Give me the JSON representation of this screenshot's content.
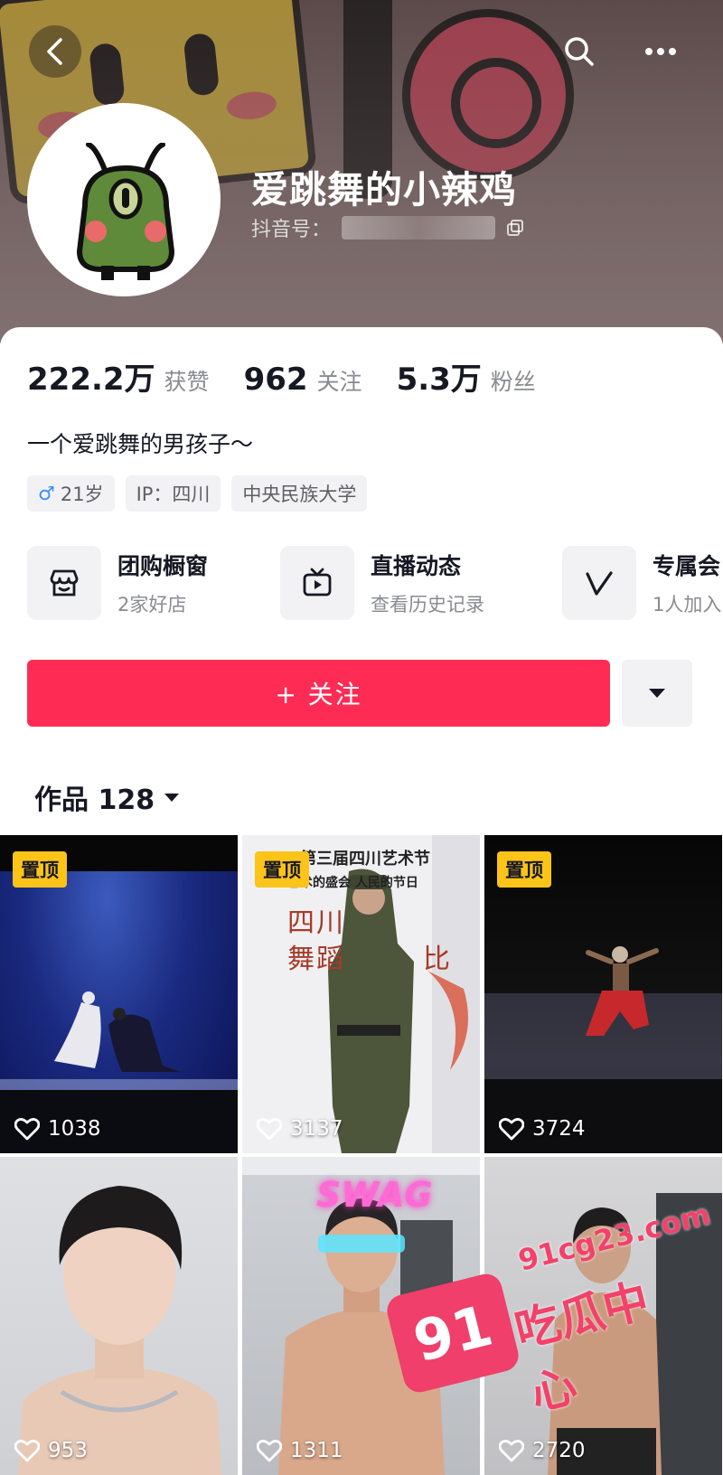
{
  "header": {
    "username": "爱跳舞的小辣鸡",
    "douyin_id_label": "抖音号："
  },
  "stats": [
    {
      "value": "222.2万",
      "label": "获赞"
    },
    {
      "value": "962",
      "label": "关注"
    },
    {
      "value": "5.3万",
      "label": "粉丝"
    }
  ],
  "bio": "一个爱跳舞的男孩子～",
  "tags": {
    "gender_symbol": "♂",
    "age": "21岁",
    "ip": "IP：四川",
    "school": "中央民族大学"
  },
  "features": [
    {
      "title": "团购橱窗",
      "subtitle": "2家好店",
      "icon": "store-icon"
    },
    {
      "title": "直播动态",
      "subtitle": "查看历史记录",
      "icon": "tv-icon"
    },
    {
      "title": "专属会",
      "subtitle": "1人加入",
      "icon": "v-icon"
    }
  ],
  "actions": {
    "follow_label": "+ 关注"
  },
  "works": {
    "label": "作品 128"
  },
  "thumbnails": [
    {
      "pinned_label": "置顶",
      "likes": "1038"
    },
    {
      "pinned_label": "置顶",
      "likes": "3137"
    },
    {
      "pinned_label": "置顶",
      "likes": "3724"
    },
    {
      "pinned_label": "",
      "likes": "953"
    },
    {
      "pinned_label": "",
      "likes": "1311"
    },
    {
      "pinned_label": "",
      "likes": "2720"
    }
  ],
  "thumbnail_overlay_text": {
    "poster_line1": "第三届四川艺术节",
    "poster_line2": "艺术的盛会 人民的节日",
    "poster_line3": "四川",
    "poster_line4": "舞蹈",
    "poster_line5": "比",
    "neon_text": "SWAG"
  },
  "watermark": {
    "url": "91cg23.com",
    "badge": "91",
    "name": "吃瓜中心"
  },
  "colors": {
    "accent": "#fe2c55",
    "pin_badge": "#fcc419",
    "watermark": "#f2426a",
    "male_symbol": "#3d8ef7"
  }
}
